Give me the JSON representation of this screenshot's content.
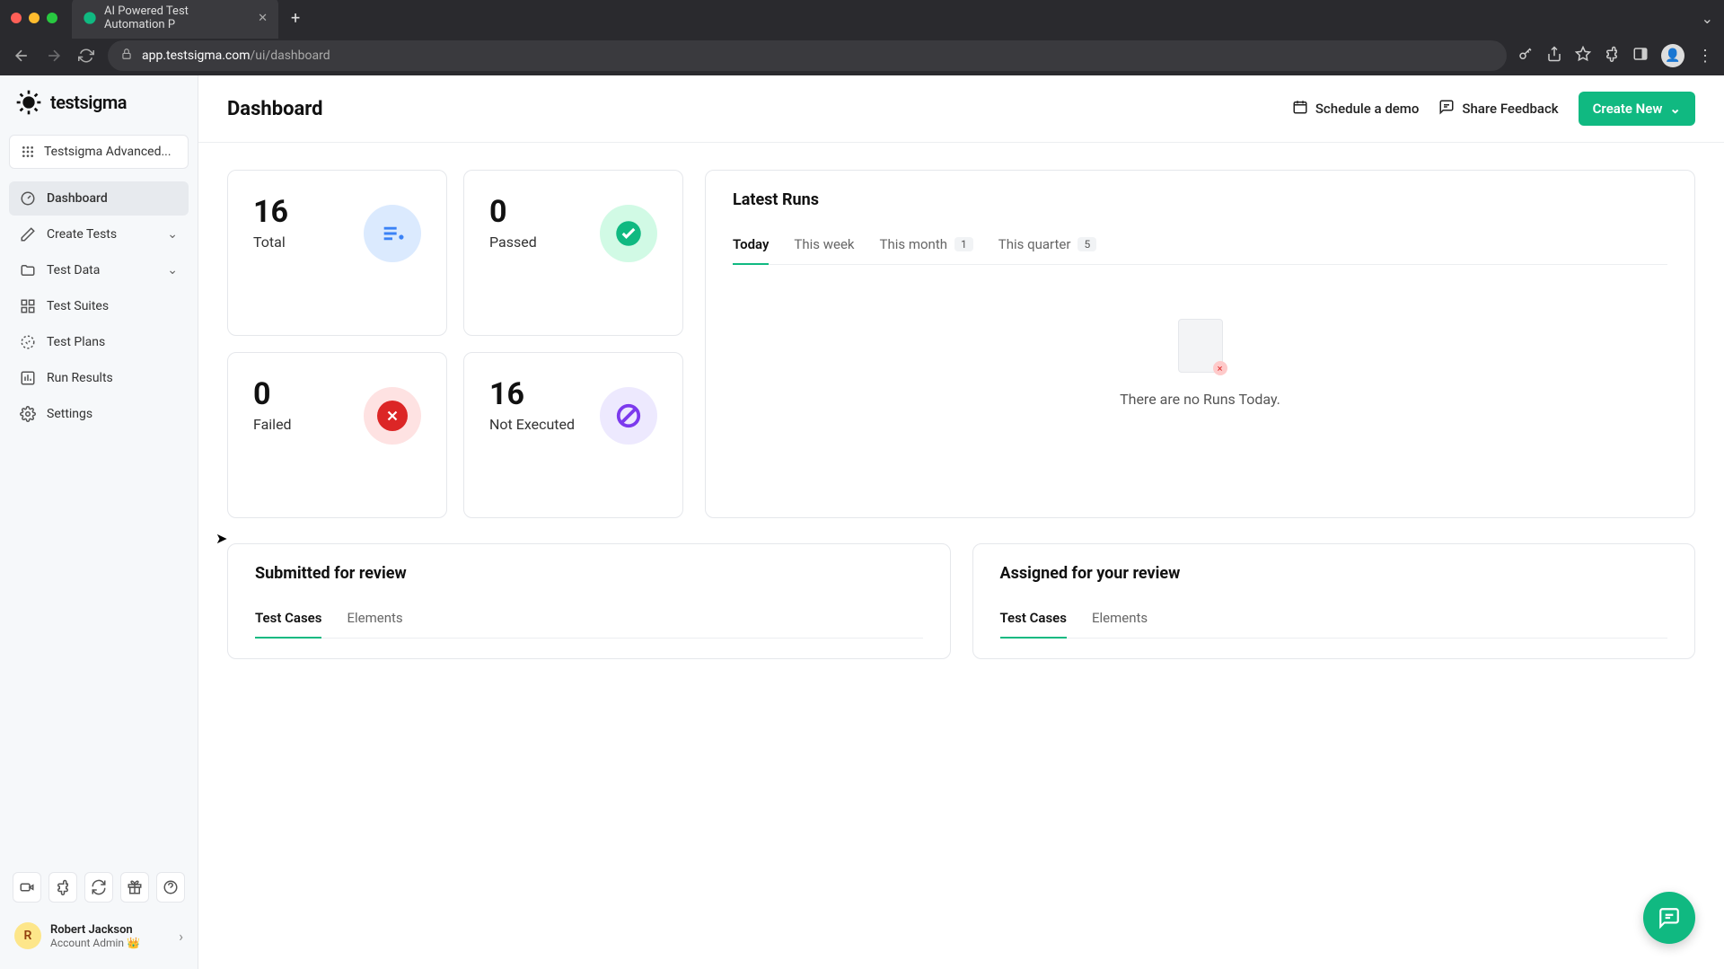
{
  "browser": {
    "tab_title": "AI Powered Test Automation P",
    "url_domain": "app.testsigma.com",
    "url_path": "/ui/dashboard"
  },
  "brand": "testsigma",
  "project_selector": "Testsigma Advanced...",
  "sidebar": {
    "items": [
      {
        "label": "Dashboard"
      },
      {
        "label": "Create Tests"
      },
      {
        "label": "Test Data"
      },
      {
        "label": "Test Suites"
      },
      {
        "label": "Test Plans"
      },
      {
        "label": "Run Results"
      },
      {
        "label": "Settings"
      }
    ]
  },
  "user": {
    "initial": "R",
    "name": "Robert Jackson",
    "role": "Account Admin 👑"
  },
  "header": {
    "title": "Dashboard",
    "schedule_demo": "Schedule a demo",
    "share_feedback": "Share Feedback",
    "create_new": "Create New"
  },
  "stats": {
    "total": {
      "value": "16",
      "label": "Total"
    },
    "passed": {
      "value": "0",
      "label": "Passed"
    },
    "failed": {
      "value": "0",
      "label": "Failed"
    },
    "not_executed": {
      "value": "16",
      "label": "Not Executed"
    }
  },
  "latest_runs": {
    "title": "Latest Runs",
    "tabs": {
      "today": "Today",
      "week": "This week",
      "month": "This month",
      "month_badge": "1",
      "quarter": "This quarter",
      "quarter_badge": "5"
    },
    "empty": "There are no Runs Today."
  },
  "submitted": {
    "title": "Submitted for review",
    "tab_cases": "Test Cases",
    "tab_elements": "Elements"
  },
  "assigned": {
    "title": "Assigned for your review",
    "tab_cases": "Test Cases",
    "tab_elements": "Elements"
  }
}
